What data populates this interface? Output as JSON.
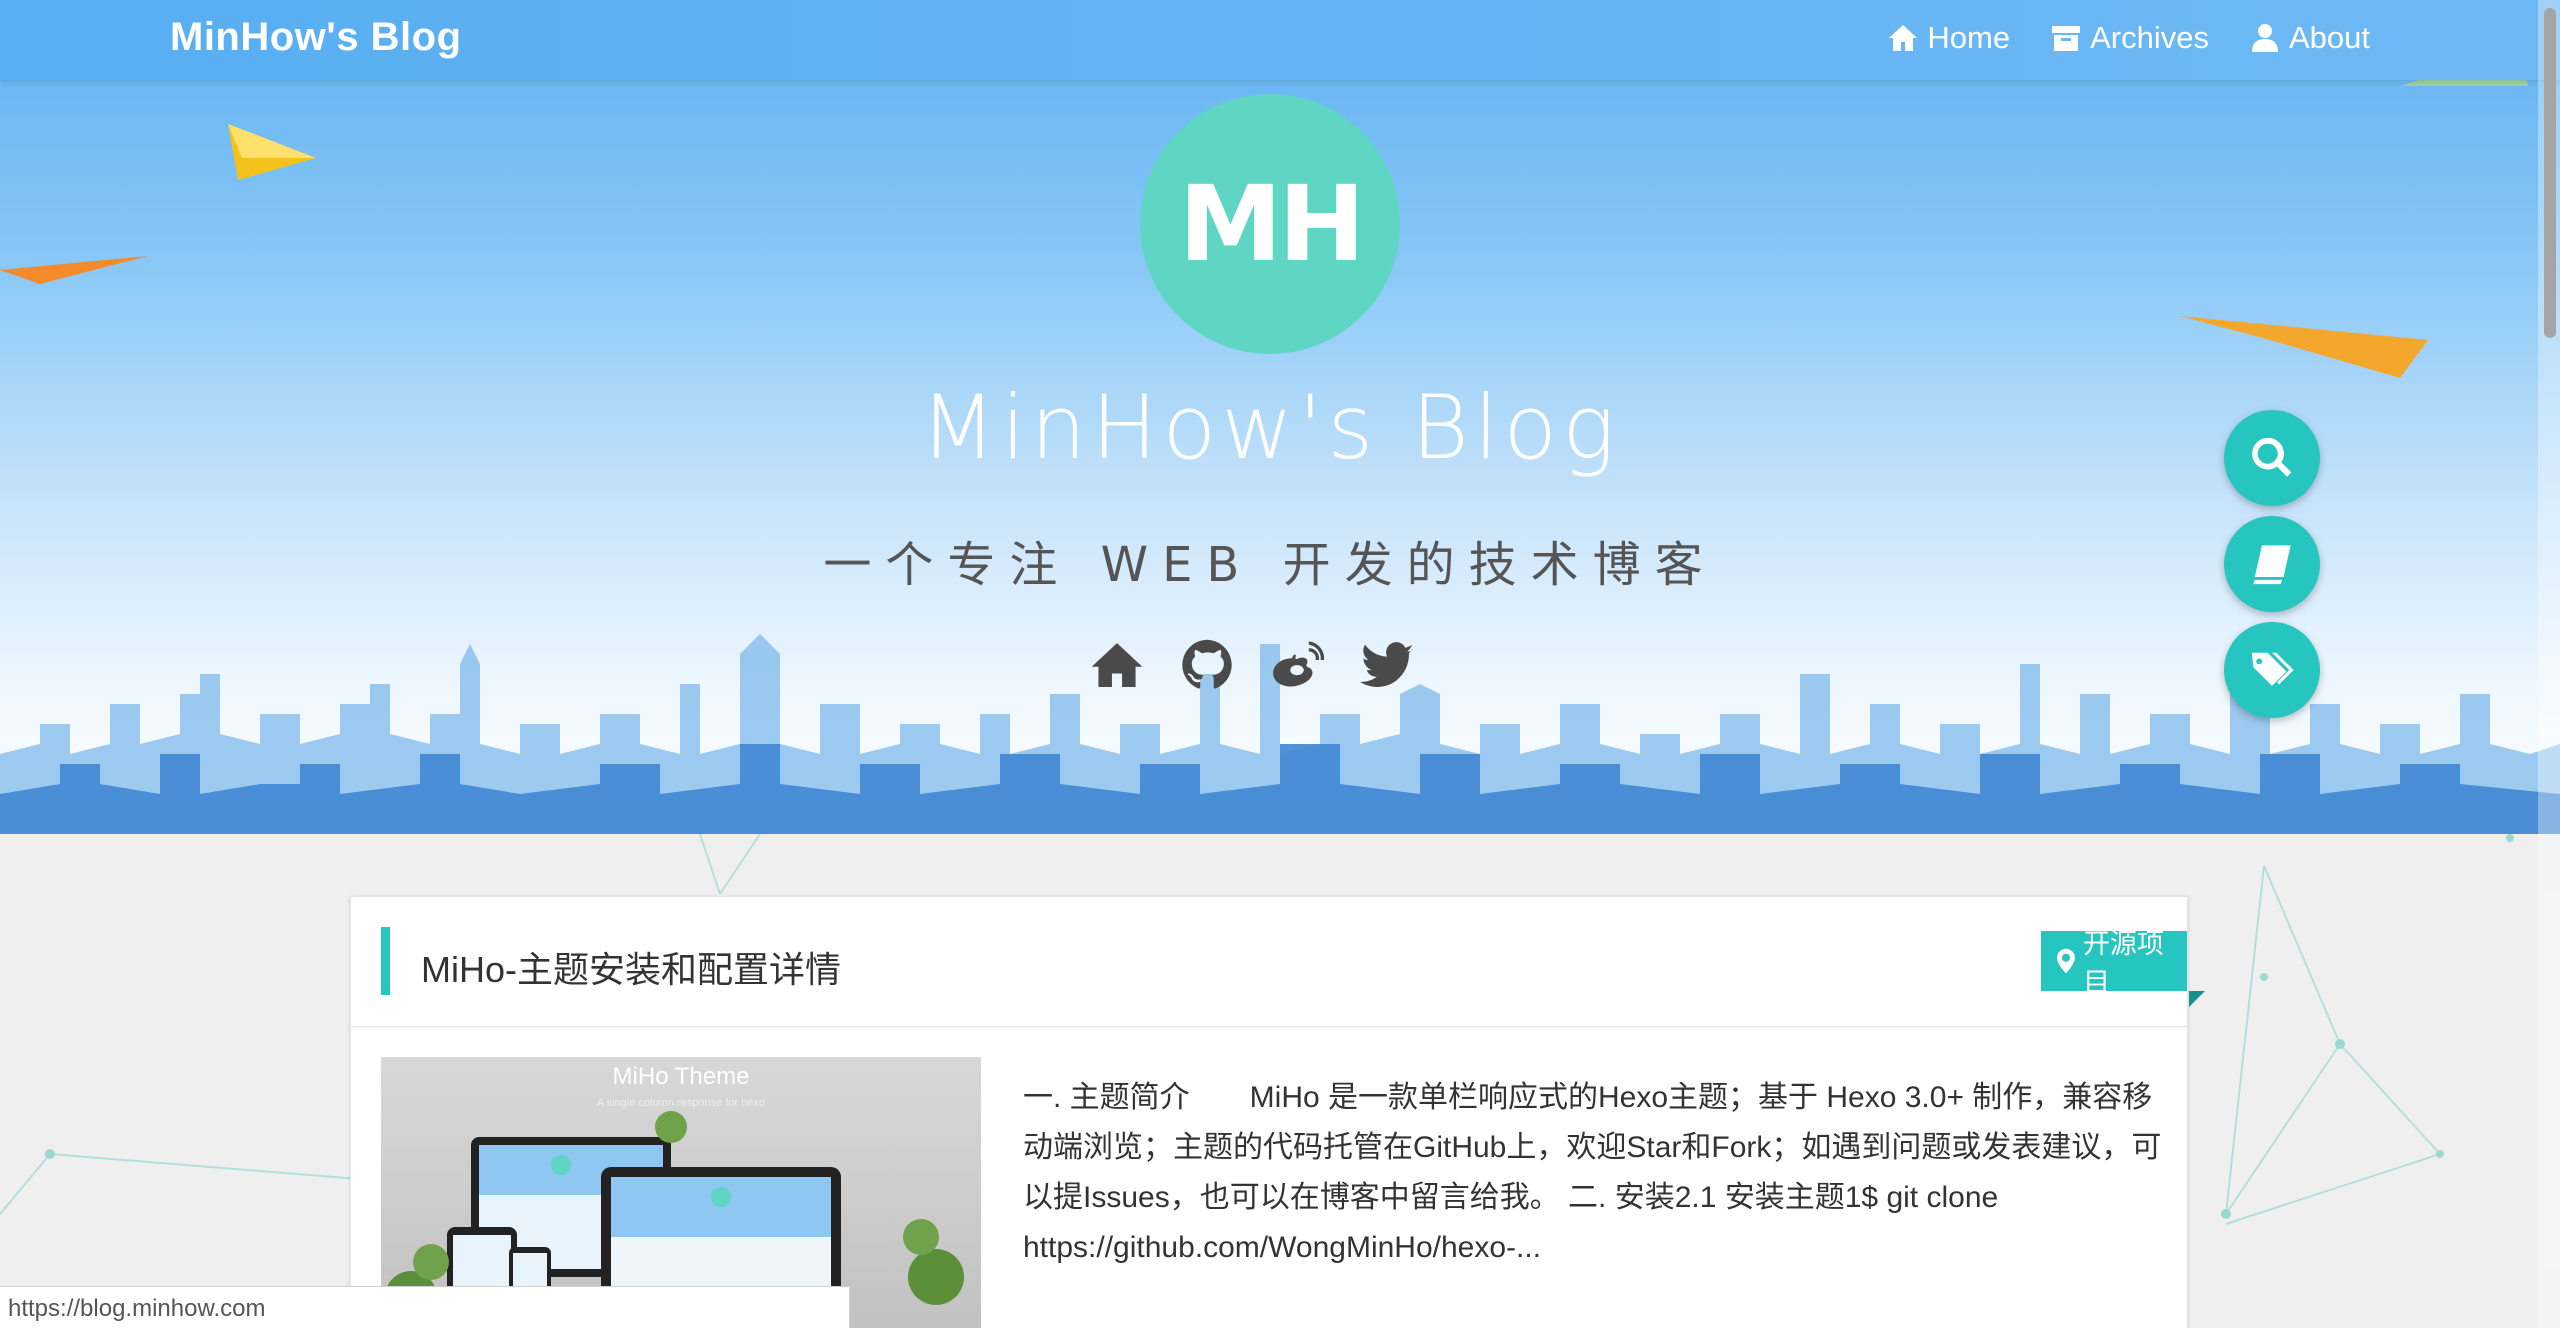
{
  "navbar": {
    "brand": "MinHow's Blog",
    "items": [
      {
        "label": "Home",
        "icon": "home-icon"
      },
      {
        "label": "Archives",
        "icon": "archive-icon"
      },
      {
        "label": "About",
        "icon": "user-icon"
      }
    ]
  },
  "hero": {
    "avatar_text": "MH",
    "title": "MinHow's Blog",
    "subtitle": "一个专注 WEB 开发的技术博客",
    "social_icons": [
      "home-icon",
      "github-icon",
      "weibo-icon",
      "twitter-icon"
    ]
  },
  "floating_buttons": [
    "search-icon",
    "book-icon",
    "tags-icon"
  ],
  "post": {
    "title": "MiHo-主题安装和配置详情",
    "category": "开源项目",
    "thumbnail_title": "MiHo Theme",
    "thumbnail_subtitle": "A single column response for hexo",
    "excerpt": "一. 主题简介　　MiHo 是一款单栏响应式的Hexo主题；基于 Hexo 3.0+ 制作，兼容移动端浏览；主题的代码托管在GitHub上，欢迎Star和Fork；如遇到问题或发表建议，可以提Issues，也可以在博客中留言给我。 二. 安装2.1 安装主题1$ git clone https://github.com/WongMinHo/hexo-..."
  },
  "status_bar": {
    "url": "https://blog.minhow.com"
  },
  "colors": {
    "accent": "#27c5c0",
    "avatar": "#5fd5c4",
    "navbar": "#58aef2"
  }
}
